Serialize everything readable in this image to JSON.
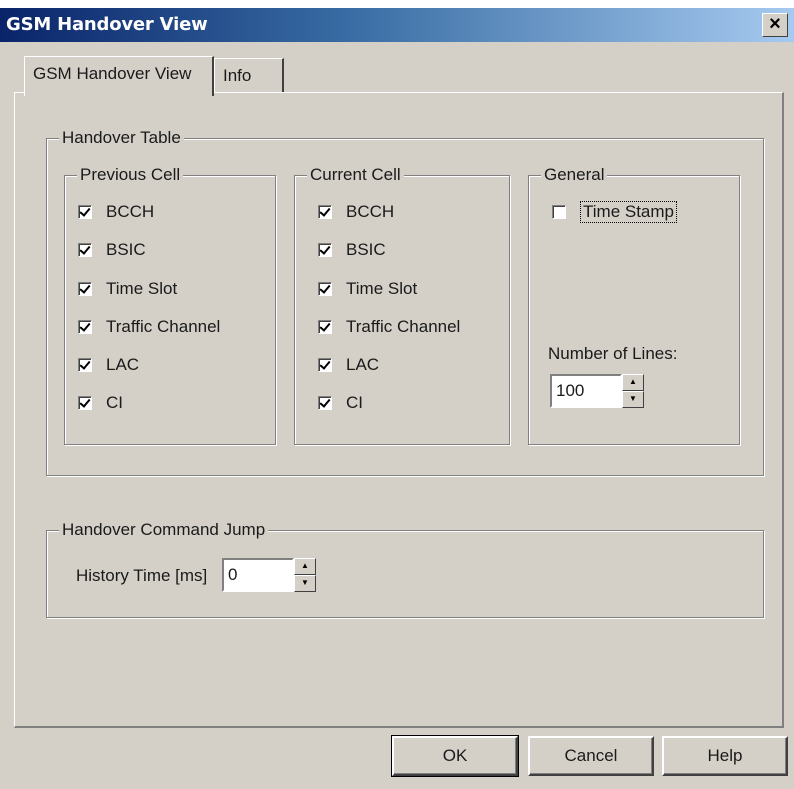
{
  "window": {
    "title": "GSM Handover View",
    "close_glyph": "×"
  },
  "tabs": [
    {
      "label": "GSM Handover View",
      "active": true
    },
    {
      "label": "Info",
      "active": false
    }
  ],
  "handover_table": {
    "label": "Handover Table",
    "previous_cell": {
      "label": "Previous Cell",
      "items": [
        {
          "label": "BCCH",
          "checked": true
        },
        {
          "label": "BSIC",
          "checked": true
        },
        {
          "label": "Time Slot",
          "checked": true
        },
        {
          "label": "Traffic Channel",
          "checked": true
        },
        {
          "label": "LAC",
          "checked": true
        },
        {
          "label": "CI",
          "checked": true
        }
      ]
    },
    "current_cell": {
      "label": "Current Cell",
      "items": [
        {
          "label": "BCCH",
          "checked": true
        },
        {
          "label": "BSIC",
          "checked": true
        },
        {
          "label": "Time Slot",
          "checked": true
        },
        {
          "label": "Traffic Channel",
          "checked": true
        },
        {
          "label": "LAC",
          "checked": true
        },
        {
          "label": "CI",
          "checked": true
        }
      ]
    },
    "general": {
      "label": "General",
      "time_stamp": {
        "label": "Time Stamp",
        "checked": false
      },
      "number_of_lines_label": "Number of Lines:",
      "number_of_lines_value": "100"
    }
  },
  "handover_command_jump": {
    "label": "Handover Command Jump",
    "history_time_label": "History Time [ms]",
    "history_time_value": "0"
  },
  "buttons": {
    "ok": "OK",
    "cancel": "Cancel",
    "help": "Help"
  },
  "icons": {
    "close": "close-icon",
    "spin_up": "spin-up-icon",
    "spin_down": "spin-down-icon",
    "check": "check-icon"
  }
}
